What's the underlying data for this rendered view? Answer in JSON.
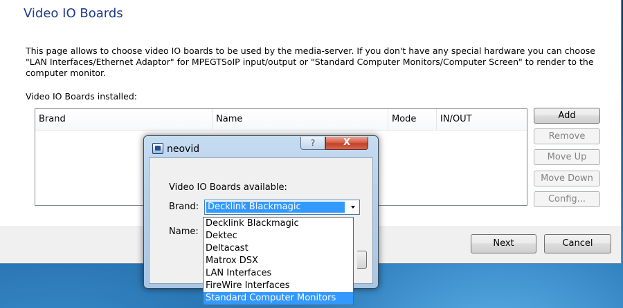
{
  "wizard": {
    "title": "Video IO Boards",
    "description": "This page allows to choose video IO boards to be used by the media-server. If you don't have any special hardware you can choose \"LAN Interfaces/Ethernet Adaptor\" for MPEGTSoIP input/output or \"Standard Computer Monitors/Computer Screen\" to render to the computer monitor.",
    "installed_label": "Video IO Boards installed:",
    "columns": [
      "Brand",
      "Name",
      "Mode",
      "IN/OUT"
    ],
    "buttons": {
      "add": "Add",
      "remove": "Remove",
      "move_up": "Move Up",
      "move_down": "Move Down",
      "config": "Config..."
    },
    "footer": {
      "next": "Next",
      "cancel": "Cancel"
    }
  },
  "dialog": {
    "title": "neovid",
    "help_glyph": "?",
    "close_glyph": "X",
    "available_label": "Video IO Boards available:",
    "brand_label": "Brand:",
    "name_label": "Name:",
    "brand_selected": "Decklink Blackmagic",
    "brand_options": [
      "Decklink Blackmagic",
      "Dektec",
      "Deltacast",
      "Matrox DSX",
      "LAN Interfaces",
      "FireWire Interfaces",
      "Standard Computer Monitors"
    ],
    "highlighted_option_index": 6
  }
}
